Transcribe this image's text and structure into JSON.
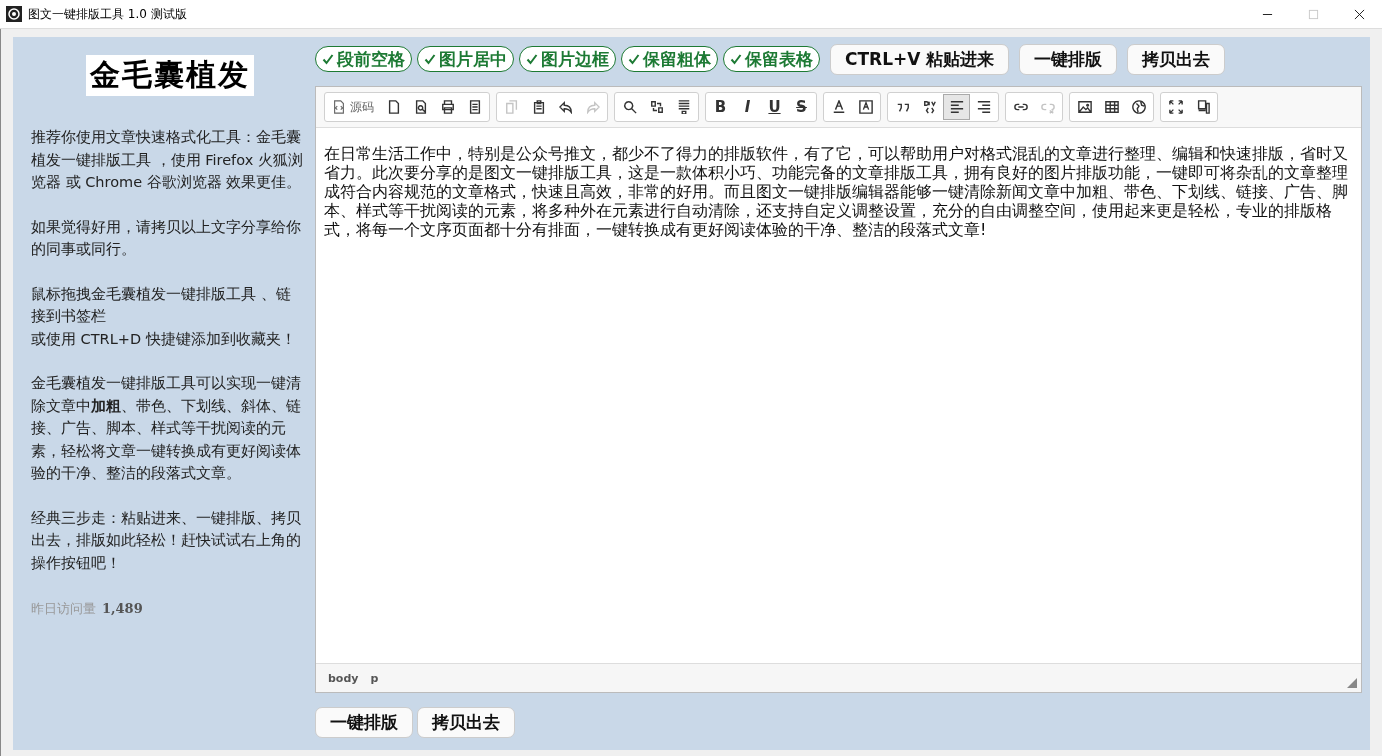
{
  "window": {
    "title": "图文一键排版工具 1.0 测试版",
    "controls": [
      {
        "kind": "minimize",
        "disabled": false
      },
      {
        "kind": "maximize",
        "disabled": true
      },
      {
        "kind": "close",
        "disabled": false
      }
    ]
  },
  "sidebar": {
    "logo": "金毛囊植发",
    "paragraphs": [
      {
        "lines": [
          "推荐你使用文章快速格式化工具：金毛囊植发一键排版工具 ，使用 Firefox 火狐浏览器 或 Chrome 谷歌浏览器 效果更佳。"
        ]
      },
      {
        "lines": [
          "如果觉得好用，请拷贝以上文字分享给你的同事或同行。"
        ]
      },
      {
        "lines": [
          "鼠标拖拽金毛囊植发一键排版工具 、链接到书签栏",
          "或使用 CTRL+D 快捷键添加到收藏夹！"
        ]
      },
      {
        "lines": [
          "金毛囊植发一键排版工具可以实现一键清除文章中**加粗**、带色、下划线、斜体、链接、广告、脚本、样式等干扰阅读的元素，轻松将文章一键转换成有更好阅读体验的干净、整洁的段落式文章。"
        ]
      },
      {
        "lines": [
          "经典三步走：粘贴进来、一键排版、拷贝出去，排版如此轻松！赶快试试右上角的操作按钮吧！"
        ]
      }
    ],
    "stats": {
      "label": "昨日访问量",
      "value": "1,489"
    }
  },
  "options": [
    {
      "label": "段前空格",
      "checked": true
    },
    {
      "label": "图片居中",
      "checked": true
    },
    {
      "label": "图片边框",
      "checked": true
    },
    {
      "label": "保留粗体",
      "checked": true
    },
    {
      "label": "保留表格",
      "checked": true
    }
  ],
  "top_buttons": [
    "CTRL+V 粘贴进来",
    "一键排版",
    "拷贝出去"
  ],
  "toolbar": [
    [
      {
        "kind": "source",
        "label": "源码",
        "selected": false,
        "disabled": false
      },
      {
        "kind": "new",
        "selected": false,
        "disabled": false
      },
      {
        "kind": "preview",
        "selected": false,
        "disabled": false
      },
      {
        "kind": "print",
        "selected": false,
        "disabled": false
      },
      {
        "kind": "template",
        "selected": false,
        "disabled": false
      }
    ],
    [
      {
        "kind": "copy",
        "selected": false,
        "disabled": true
      },
      {
        "kind": "paste",
        "selected": false,
        "disabled": false
      },
      {
        "kind": "undo",
        "selected": false,
        "disabled": false
      },
      {
        "kind": "redo",
        "selected": false,
        "disabled": true
      }
    ],
    [
      {
        "kind": "find",
        "selected": false,
        "disabled": false
      },
      {
        "kind": "replace",
        "selected": false,
        "disabled": false
      },
      {
        "kind": "select-all",
        "selected": false,
        "disabled": false
      }
    ],
    [
      {
        "kind": "letter",
        "label": "B",
        "selected": false,
        "disabled": false
      },
      {
        "kind": "letter",
        "label": "I",
        "selected": false,
        "disabled": false
      },
      {
        "kind": "letter",
        "label": "U",
        "selected": false,
        "disabled": false
      },
      {
        "kind": "letter",
        "label": "S",
        "selected": false,
        "disabled": false
      }
    ],
    [
      {
        "kind": "text-color",
        "selected": false,
        "disabled": false
      },
      {
        "kind": "bg-color",
        "selected": false,
        "disabled": false
      }
    ],
    [
      {
        "kind": "quote",
        "selected": false,
        "disabled": false
      },
      {
        "kind": "div",
        "selected": false,
        "disabled": false
      },
      {
        "kind": "align-left",
        "selected": true,
        "disabled": false
      },
      {
        "kind": "align-right",
        "selected": false,
        "disabled": false
      }
    ],
    [
      {
        "kind": "link",
        "selected": false,
        "disabled": false
      },
      {
        "kind": "unlink",
        "selected": false,
        "disabled": true
      }
    ],
    [
      {
        "kind": "image",
        "selected": false,
        "disabled": false
      },
      {
        "kind": "table",
        "selected": false,
        "disabled": false
      },
      {
        "kind": "globe",
        "selected": false,
        "disabled": false
      }
    ],
    [
      {
        "kind": "maximize",
        "selected": false,
        "disabled": false
      },
      {
        "kind": "blocks",
        "selected": false,
        "disabled": false
      }
    ]
  ],
  "editor": {
    "content": "在日常生活工作中，特别是公众号推文，都少不了得力的排版软件，有了它，可以帮助用户对格式混乱的文章进行整理、编辑和快速排版，省时又省力。此次要分享的是图文一键排版工具，这是一款体积小巧、功能完备的文章排版工具，拥有良好的图片排版功能，一键即可将杂乱的文章整理成符合内容规范的文章格式，快速且高效，非常的好用。而且图文一键排版编辑器能够一键清除新闻文章中加粗、带色、下划线、链接、广告、脚本、样式等干扰阅读的元素，将多种外在元素进行自动清除，还支持自定义调整设置，充分的自由调整空间，使用起来更是轻松，专业的排版格式，将每一个文序页面都十分有排面，一键转换成有更好阅读体验的干净、整洁的段落式文章!",
    "path": [
      "body",
      "p"
    ]
  },
  "bottom_buttons": [
    "一键排版",
    "拷贝出去"
  ]
}
